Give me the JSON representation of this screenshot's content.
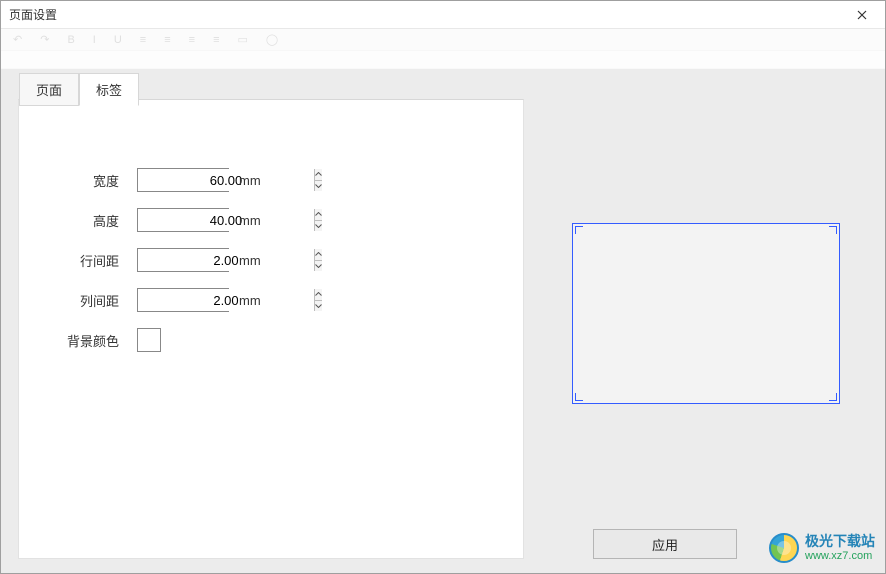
{
  "window": {
    "title": "页面设置"
  },
  "tabs": {
    "page": "页面",
    "label": "标签"
  },
  "form": {
    "width": {
      "label": "宽度",
      "value": "60.00",
      "unit": "mm"
    },
    "height": {
      "label": "高度",
      "value": "40.00",
      "unit": "mm"
    },
    "rowgap": {
      "label": "行间距",
      "value": "2.00",
      "unit": "mm"
    },
    "colgap": {
      "label": "列间距",
      "value": "2.00",
      "unit": "mm"
    },
    "bgcolor": {
      "label": "背景颜色",
      "value": "#ffffff"
    }
  },
  "buttons": {
    "apply": "应用"
  },
  "watermark": {
    "name": "极光下载站",
    "url": "www.xz7.com"
  }
}
